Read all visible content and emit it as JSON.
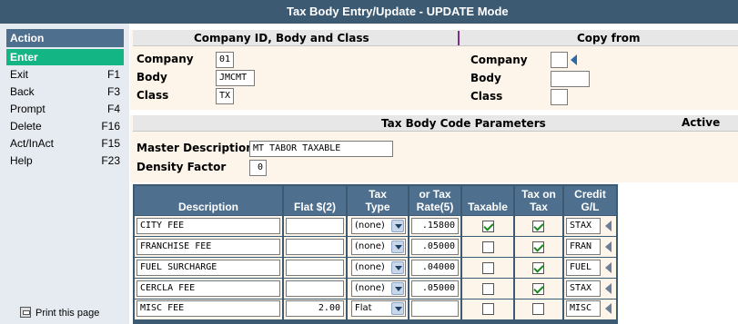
{
  "window": {
    "title": "Tax Body Entry/Update - UPDATE Mode"
  },
  "sidebar": {
    "header": "Action",
    "items": [
      {
        "label": "Enter",
        "key": "",
        "active": true
      },
      {
        "label": "Exit",
        "key": "F1"
      },
      {
        "label": "Back",
        "key": "F3"
      },
      {
        "label": "Prompt",
        "key": "F4"
      },
      {
        "label": "Delete",
        "key": "F16"
      },
      {
        "label": "Act/InAct",
        "key": "F15"
      },
      {
        "label": "Help",
        "key": "F23"
      }
    ],
    "print_label": "Print this page"
  },
  "company_section": {
    "title": "Company ID, Body and Class",
    "copy_title": "Copy from",
    "company_label": "Company",
    "company_value": "01",
    "body_label": "Body",
    "body_value": "JMCMT",
    "class_label": "Class",
    "class_value": "TX",
    "copy_company_label": "Company",
    "copy_company_value": "",
    "copy_body_label": "Body",
    "copy_body_value": "",
    "copy_class_label": "Class",
    "copy_class_value": ""
  },
  "params_section": {
    "title": "Tax Body Code Parameters",
    "status": "Active",
    "master_desc_label": "Master Description",
    "master_desc_value": "MT TABOR TAXABLE",
    "density_label": "Density Factor",
    "density_value": "0"
  },
  "table": {
    "headers": {
      "description": "Description",
      "flat": "Flat $(2)",
      "tax_type_1": "Tax",
      "tax_type_2": "Type",
      "rate_1": "or Tax",
      "rate_2": "Rate(5)",
      "taxable": "Taxable",
      "tax_on_tax_1": "Tax on",
      "tax_on_tax_2": "Tax",
      "credit_1": "Credit",
      "credit_2": "G/L"
    },
    "rows": [
      {
        "description": "CITY FEE",
        "flat": "",
        "type": "(none)",
        "rate": ".15800",
        "taxable": true,
        "tax_on_tax": true,
        "gl": "STAX"
      },
      {
        "description": "FRANCHISE FEE",
        "flat": "",
        "type": "(none)",
        "rate": ".05000",
        "taxable": false,
        "tax_on_tax": true,
        "gl": "FRAN"
      },
      {
        "description": "FUEL SURCHARGE",
        "flat": "",
        "type": "(none)",
        "rate": ".04000",
        "taxable": false,
        "tax_on_tax": true,
        "gl": "FUEL"
      },
      {
        "description": "CERCLA FEE",
        "flat": "",
        "type": "(none)",
        "rate": ".05000",
        "taxable": false,
        "tax_on_tax": true,
        "gl": "STAX"
      },
      {
        "description": "MISC FEE",
        "flat": "2.00",
        "type": "Flat",
        "rate": "",
        "taxable": false,
        "tax_on_tax": false,
        "gl": "MISC"
      }
    ]
  }
}
